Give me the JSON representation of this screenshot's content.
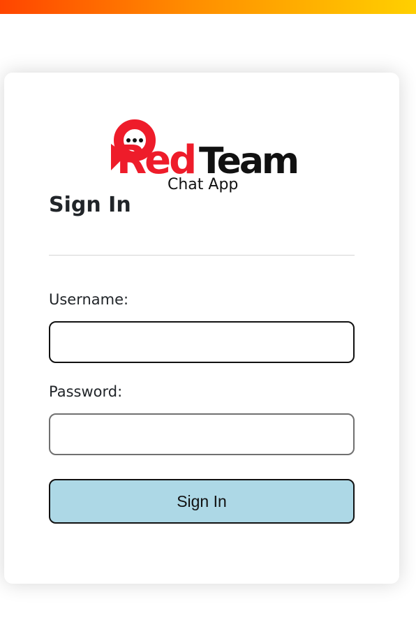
{
  "brand": {
    "logo_text_red": "Red",
    "logo_text_black": "Team",
    "logo_subtitle": "Chat App",
    "accent_color": "#ee1c2a",
    "logo_dark_color": "#111111",
    "icon": "chat-bubble-icon"
  },
  "form": {
    "title": "Sign In",
    "username_label": "Username:",
    "username_value": "",
    "password_label": "Password:",
    "password_value": "",
    "submit_label": "Sign In",
    "submit_color": "#add8e6"
  },
  "theme": {
    "top_bar_gradient": [
      "#ff4500",
      "#ff8c00",
      "#ffd000"
    ]
  }
}
